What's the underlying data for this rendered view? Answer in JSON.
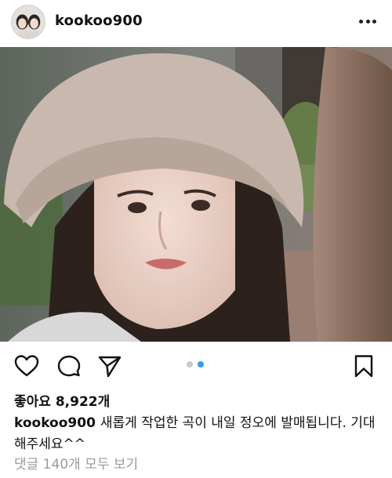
{
  "post": {
    "username": "kookoo900",
    "likes": "좋아요 8,922개",
    "caption_user": "kookoo900",
    "caption_text": "새롭게 작업한 곡이 내일 정오에 발매됩니다. 기대해주세요^^",
    "view_comments": "댓글 140개 모두 보기"
  },
  "icons": {
    "more": "more-options-icon",
    "like": "heart-icon",
    "comment": "comment-icon",
    "share": "send-icon",
    "save": "bookmark-icon"
  },
  "carousel": {
    "total": 2,
    "active": 2
  },
  "colors": {
    "text": "#111111",
    "muted": "#9a9a9a",
    "carousel_active": "#3897f0",
    "carousel_inactive": "#c8c8c8"
  }
}
